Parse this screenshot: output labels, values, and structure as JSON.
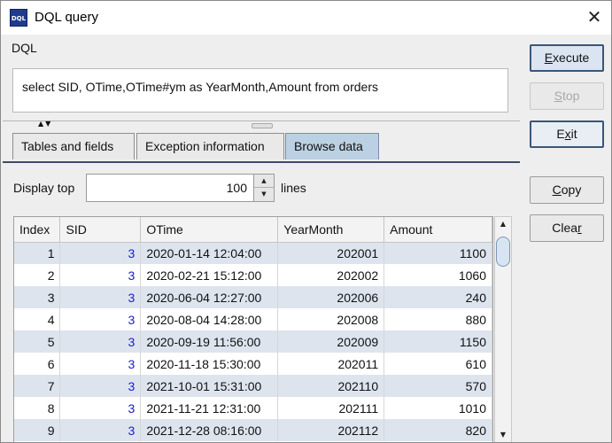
{
  "window": {
    "title": "DQL query",
    "app_icon_text": "DQL"
  },
  "dql": {
    "label": "DQL",
    "query": "select SID, OTime,OTime#ym as YearMonth,Amount from orders"
  },
  "tabs": [
    {
      "label": "Tables and fields",
      "active": false
    },
    {
      "label": "Exception information",
      "active": false
    },
    {
      "label": "Browse data",
      "active": true
    }
  ],
  "display": {
    "label": "Display top",
    "value": "100",
    "suffix": "lines"
  },
  "table": {
    "columns": [
      "Index",
      "SID",
      "OTime",
      "YearMonth",
      "Amount"
    ],
    "rows": [
      [
        "1",
        "3",
        "2020-01-14 12:04:00",
        "202001",
        "1100"
      ],
      [
        "2",
        "3",
        "2020-02-21 15:12:00",
        "202002",
        "1060"
      ],
      [
        "3",
        "3",
        "2020-06-04 12:27:00",
        "202006",
        "240"
      ],
      [
        "4",
        "3",
        "2020-08-04 14:28:00",
        "202008",
        "880"
      ],
      [
        "5",
        "3",
        "2020-09-19 11:56:00",
        "202009",
        "1150"
      ],
      [
        "6",
        "3",
        "2020-11-18 15:30:00",
        "202011",
        "610"
      ],
      [
        "7",
        "3",
        "2021-10-01 15:31:00",
        "202110",
        "570"
      ],
      [
        "8",
        "3",
        "2021-11-21 12:31:00",
        "202111",
        "1010"
      ],
      [
        "9",
        "3",
        "2021-12-28 08:16:00",
        "202112",
        "820"
      ]
    ]
  },
  "buttons": {
    "execute": {
      "pre": "",
      "mnemonic": "E",
      "post": "xecute",
      "enabled": true
    },
    "stop": {
      "pre": "",
      "mnemonic": "S",
      "post": "top",
      "enabled": false
    },
    "exit": {
      "pre": "E",
      "mnemonic": "x",
      "post": "it",
      "enabled": true
    },
    "copy": {
      "pre": "",
      "mnemonic": "C",
      "post": "opy",
      "enabled": true
    },
    "clear": {
      "pre": "Clea",
      "mnemonic": "r",
      "post": "",
      "enabled": true
    }
  },
  "colors": {
    "active_tab": "#bcd0e3",
    "row_stripe": "#dde4ee",
    "sid_text": "#1a1ad0",
    "default_button_border": "#3a5678"
  }
}
